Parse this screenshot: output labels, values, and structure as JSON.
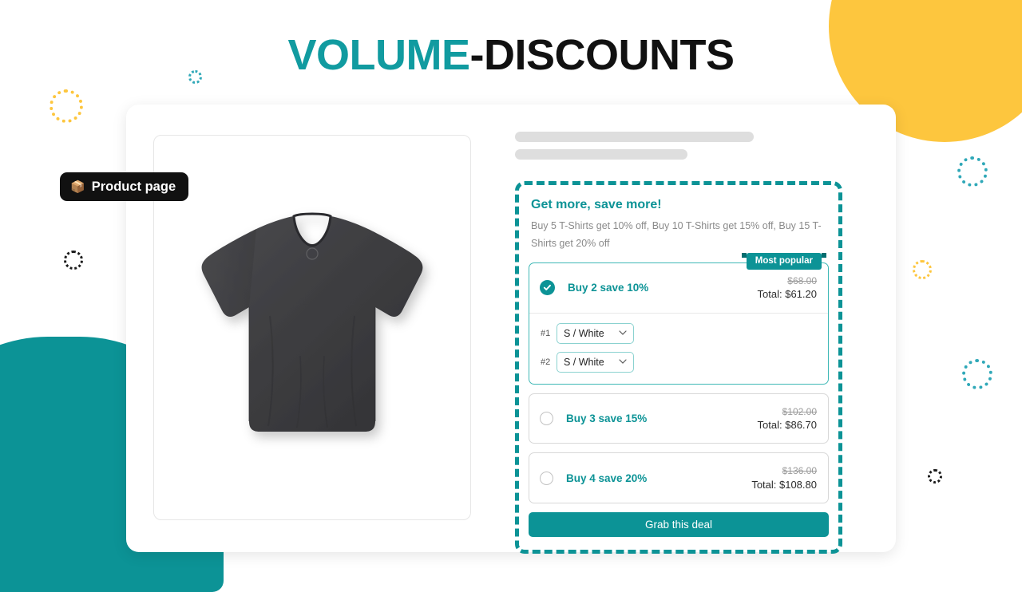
{
  "page": {
    "title_accent": "VOLUME",
    "title_rest": "-DISCOUNTS"
  },
  "badge": {
    "icon": "package-icon",
    "emoji": "📦",
    "label": "Product page"
  },
  "product": {
    "image_alt": "Dark grey crew neck t-shirt"
  },
  "offer": {
    "heading": "Get more, save more!",
    "subtitle": "Buy 5 T-Shirts get 10% off, Buy 10 T-Shirts get 15% off, Buy 15 T-Shirts get 20% off",
    "ribbon_label": "Most popular",
    "cta_label": "Grab this deal",
    "tiers": [
      {
        "label": "Buy 2 save 10%",
        "old_price": "$68.00",
        "total": "Total: $61.20",
        "selected": true,
        "variants": [
          {
            "index": "#1",
            "value": "S / White"
          },
          {
            "index": "#2",
            "value": "S / White"
          }
        ]
      },
      {
        "label": "Buy 3 save 15%",
        "old_price": "$102.00",
        "total": "Total: $86.70",
        "selected": false
      },
      {
        "label": "Buy 4 save 20%",
        "old_price": "$136.00",
        "total": "Total: $108.80",
        "selected": false
      }
    ]
  },
  "colors": {
    "teal": "#0C9396",
    "teal_title": "#119BA0",
    "yellow": "#FDC63E",
    "dark": "#111111"
  }
}
